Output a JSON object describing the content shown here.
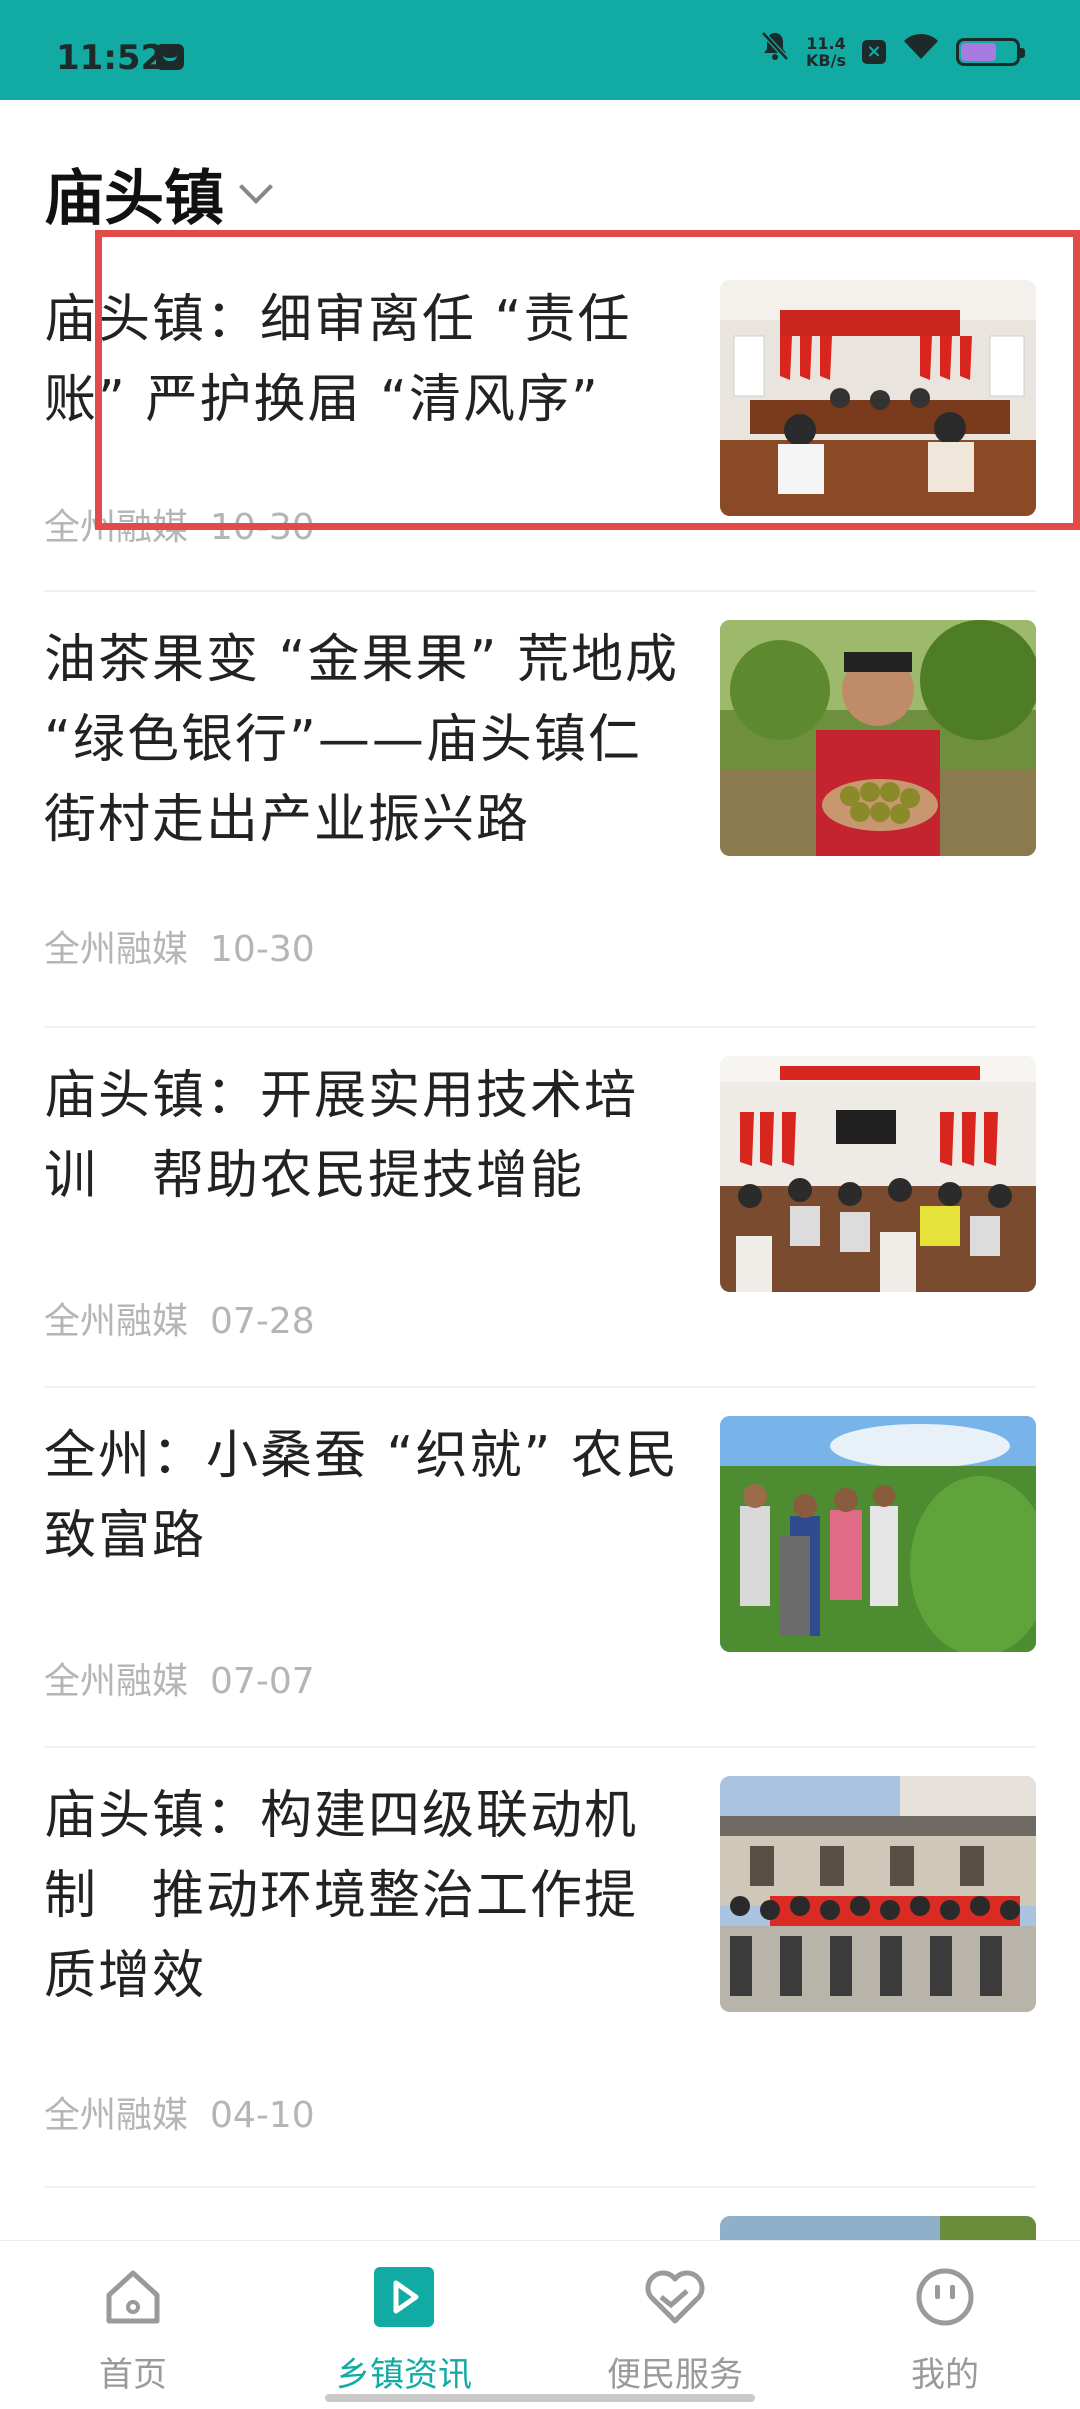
{
  "status_bar": {
    "time": "11:52",
    "speed_value": "11.4",
    "speed_unit": "KB/s",
    "icons": [
      "message-icon",
      "mute-icon",
      "close-box-icon",
      "wifi-icon",
      "battery-icon"
    ],
    "battery_level": 0.6
  },
  "header": {
    "title": "庙头镇",
    "dropdown_icon": "chevron-down-icon"
  },
  "news": [
    {
      "title": "庙头镇：细审离任 “责任账” 严护换届 “清风序”",
      "source": "全州融媒",
      "date": "10-30",
      "thumb": "meeting-hall-red-flags"
    },
    {
      "title": "油茶果变 “金果果” 荒地成 “绿色银行”——庙头镇仁街村走出产业振兴路",
      "source": "全州融媒",
      "date": "10-30",
      "thumb": "man-holding-camellia-fruit"
    },
    {
      "title": "庙头镇：开展实用技术培训　帮助农民提技增能",
      "source": "全州融媒",
      "date": "07-28",
      "thumb": "training-meeting"
    },
    {
      "title": "全州：小桑蚕 “织就” 农民致富路",
      "source": "全州融媒",
      "date": "07-07",
      "thumb": "mulberry-field-visit"
    },
    {
      "title": "庙头镇：构建四级联动机制　推动环境整治工作提质增效",
      "source": "全州融媒",
      "date": "04-10",
      "thumb": "group-photo-banner"
    }
  ],
  "nav": [
    {
      "label": "首页",
      "icon": "home-icon",
      "active": false
    },
    {
      "label": "乡镇资讯",
      "icon": "play-icon",
      "active": true
    },
    {
      "label": "便民服务",
      "icon": "heart-handshake-icon",
      "active": false
    },
    {
      "label": "我的",
      "icon": "smiley-icon",
      "active": false
    }
  ],
  "colors": {
    "accent": "#12ABA3",
    "highlight_border": "#e34a4a",
    "meta_text": "#b5b5b5",
    "nav_inactive": "#9a9a9a"
  }
}
